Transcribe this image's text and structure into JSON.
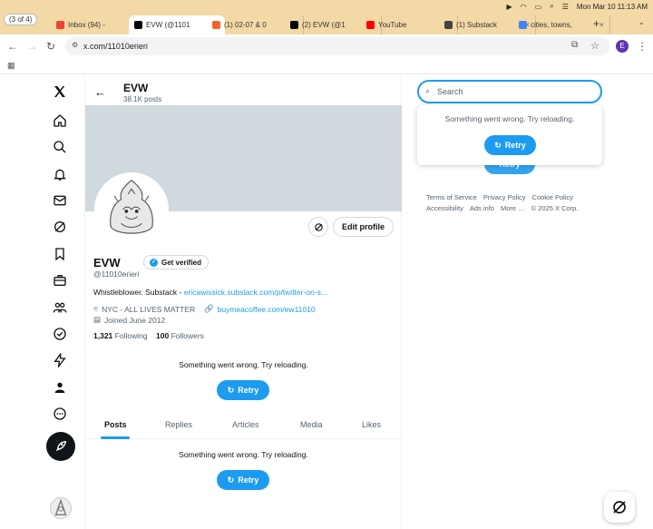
{
  "os_bar": {
    "date_time": "Mon Mar 10  11:13 AM"
  },
  "tab_count": "(3 of 4)",
  "tabs": [
    {
      "title": "Inbox (94) -",
      "color": "#ea4335"
    },
    {
      "title": "EVW (@1101",
      "color": "#000000"
    },
    {
      "title": "(1) 02-07 & 0",
      "color": "#f0642c"
    },
    {
      "title": "(2) EVW (@1",
      "color": "#000000"
    },
    {
      "title": "YouTube",
      "color": "#ff0000"
    },
    {
      "title": "(1) Substack",
      "color": "#444444"
    },
    {
      "title": "cities, towns,",
      "color": "#4285f4"
    }
  ],
  "address_bar": {
    "url": "x.com/11010erieri",
    "profile_initial": "E"
  },
  "profile": {
    "header_name": "EVW",
    "posts_count": "38.1K posts",
    "name": "EVW",
    "get_verified": "Get verified",
    "handle": "@11010erieri",
    "bio_text": "Whistleblower. Substack - ",
    "bio_link": "ericawissick.substack.com/p/twitter-on-s…",
    "location": "NYC - ALL LIVES MATTER",
    "website": "buymeacoffee.com/ew11010",
    "joined": "Joined June 2012",
    "following_count": "1,321",
    "following_label": "Following",
    "followers_count": "100",
    "followers_label": "Followers",
    "edit_profile": "Edit profile"
  },
  "errors": {
    "message": "Something went wrong. Try reloading.",
    "retry": "Retry"
  },
  "profile_tabs": [
    "Posts",
    "Replies",
    "Articles",
    "Media",
    "Likes"
  ],
  "search": {
    "placeholder": "Search"
  },
  "footer": {
    "terms": "Terms of Service",
    "privacy": "Privacy Policy",
    "cookie": "Cookie Policy",
    "accessibility": "Accessibility",
    "ads": "Ads info",
    "more": "More …",
    "copyright": "© 2025 X Corp."
  },
  "colors": {
    "accent": "#1d9bf0",
    "text": "#0f1419",
    "muted": "#536471"
  }
}
